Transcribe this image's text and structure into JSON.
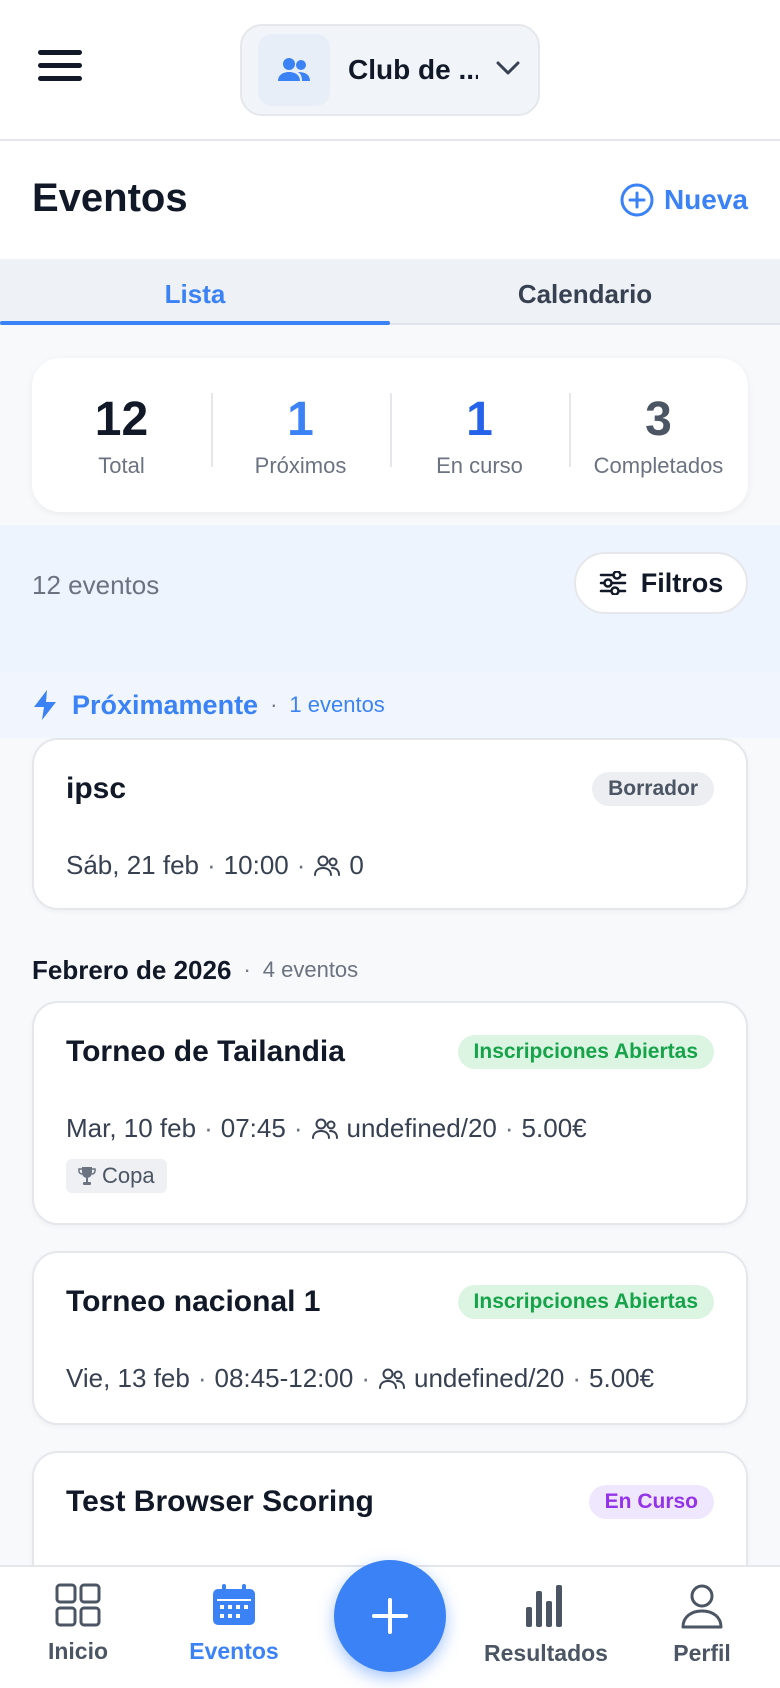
{
  "topbar": {
    "club_name": "Club de ..."
  },
  "header": {
    "title": "Eventos",
    "new_label": "Nueva"
  },
  "tabs": [
    {
      "label": "Lista"
    },
    {
      "label": "Calendario"
    }
  ],
  "stats": [
    {
      "value": "12",
      "label": "Total",
      "color": "#111827"
    },
    {
      "value": "1",
      "label": "Próximos",
      "color": "#3b82f6"
    },
    {
      "value": "1",
      "label": "En curso",
      "color": "#2563eb"
    },
    {
      "value": "3",
      "label": "Completados",
      "color": "#4b5563"
    }
  ],
  "filter": {
    "count_text": "12 eventos",
    "filters_label": "Filtros"
  },
  "sections": {
    "soon": {
      "title": "Próximamente",
      "count": "1 eventos"
    },
    "feb": {
      "title": "Febrero de 2026",
      "count": "4 eventos"
    }
  },
  "events": [
    {
      "title": "ipsc",
      "status": "Borrador",
      "date": "Sáb, 21 feb",
      "time": "10:00",
      "participants": "0",
      "price": ""
    },
    {
      "title": "Torneo de Tailandia",
      "status": "Inscripciones Abiertas",
      "date": "Mar, 10 feb",
      "time": "07:45",
      "participants": "undefined/20",
      "price": "5.00€",
      "tag": "Copa"
    },
    {
      "title": "Torneo nacional 1",
      "status": "Inscripciones Abiertas",
      "date": "Vie, 13 feb",
      "time": "08:45-12:00",
      "participants": "undefined/20",
      "price": "5.00€"
    },
    {
      "title": "Test Browser Scoring",
      "status": "En Curso"
    }
  ],
  "nav": [
    {
      "label": "Inicio",
      "icon": "grid-icon"
    },
    {
      "label": "Eventos",
      "icon": "calendar-icon"
    },
    {
      "label": "Resultados",
      "icon": "bar-chart-icon"
    },
    {
      "label": "Perfil",
      "icon": "user-icon"
    }
  ],
  "colors": {
    "accent": "#3b82f6",
    "open": "#16a34a",
    "live": "#9333ea"
  }
}
